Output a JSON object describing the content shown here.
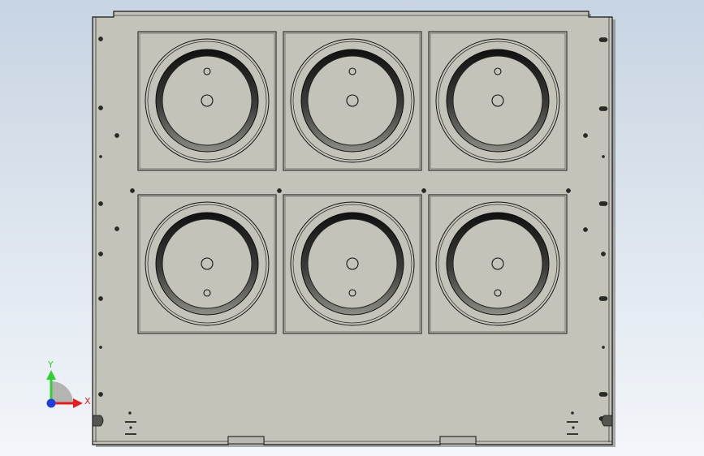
{
  "viewport": {
    "background_top": "#c7d4e2",
    "background_bottom": "#f3f6fa"
  },
  "part": {
    "fill": "#c3c3ba",
    "edge": "#141414",
    "bay_rows": 2,
    "bay_cols": 3
  },
  "triad": {
    "y_label": "Y",
    "x_label": "X",
    "y_color": "#2fd02f",
    "x_color": "#e02020",
    "z_color": "#1f3fd8"
  }
}
